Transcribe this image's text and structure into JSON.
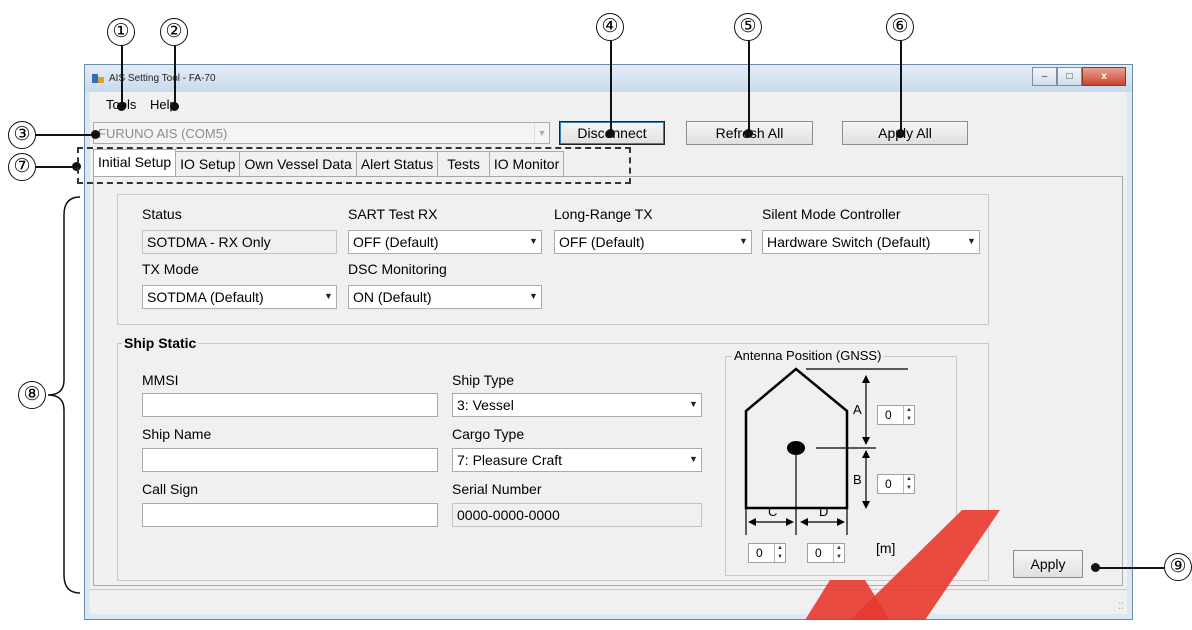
{
  "window": {
    "title": "AIS Setting Tool - FA-70",
    "controls": {
      "minimize": "–",
      "maximize": "□",
      "close": "x"
    }
  },
  "menu": {
    "tools": "Tools",
    "help": "Help"
  },
  "toolbar": {
    "device_combo": "FURUNO AIS (COM5)",
    "disconnect": "Disconnect",
    "refresh_all": "Refresh All",
    "apply_all": "Apply All"
  },
  "tabs": [
    "Initial Setup",
    "IO Setup",
    "Own Vessel Data",
    "Alert Status",
    "Tests",
    "IO Monitor"
  ],
  "initial_setup": {
    "status": {
      "label": "Status",
      "value": "SOTDMA - RX Only"
    },
    "sart_test_rx": {
      "label": "SART Test RX",
      "value": "OFF (Default)"
    },
    "long_range_tx": {
      "label": "Long-Range TX",
      "value": "OFF (Default)"
    },
    "silent_mode": {
      "label": "Silent Mode Controller",
      "value": "Hardware Switch (Default)"
    },
    "tx_mode": {
      "label": "TX Mode",
      "value": "SOTDMA (Default)"
    },
    "dsc_monitoring": {
      "label": "DSC Monitoring",
      "value": "ON (Default)"
    }
  },
  "ship_static": {
    "title": "Ship Static",
    "mmsi": {
      "label": "MMSI",
      "value": ""
    },
    "ship_name": {
      "label": "Ship Name",
      "value": ""
    },
    "call_sign": {
      "label": "Call Sign",
      "value": ""
    },
    "ship_type": {
      "label": "Ship Type",
      "value": "3: Vessel"
    },
    "cargo_type": {
      "label": "Cargo Type",
      "value": "7: Pleasure Craft"
    },
    "serial_number": {
      "label": "Serial Number",
      "value": "0000-0000-0000"
    }
  },
  "antenna": {
    "title": "Antenna Position (GNSS)",
    "a_label": "A",
    "b_label": "B",
    "c_label": "C",
    "d_label": "D",
    "a_value": "0",
    "b_value": "0",
    "c_value": "0",
    "d_value": "0",
    "unit": "[m]"
  },
  "apply_button": "Apply",
  "callouts": [
    "①",
    "②",
    "③",
    "④",
    "⑤",
    "⑥",
    "⑦",
    "⑧",
    "⑨"
  ],
  "watermark": {
    "color": "#e8382e"
  },
  "icons": {
    "dropdown": "chevron-down-icon",
    "spinner": "spinner-icon",
    "app": "app-icon"
  }
}
